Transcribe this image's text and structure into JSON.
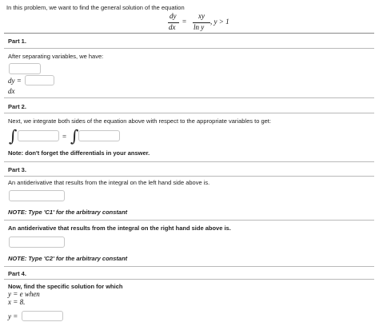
{
  "intro": {
    "text": "In this problem, we want to find the general solution of the equation",
    "equation": {
      "lhs_num": "dy",
      "lhs_den": "dx",
      "equals": "=",
      "rhs_num": "xy",
      "rhs_den": "ln y",
      "condition": ", y > 1"
    }
  },
  "part1": {
    "title": "Part 1.",
    "text": "After separating variables, we have:",
    "dy_label": "dy =",
    "dx_label": "dx"
  },
  "part2": {
    "title": "Part 2.",
    "text": "Next, we integrate both sides of the equation above with respect to the appropriate variables to get:",
    "integral_symbol": "∫",
    "equals": "=",
    "note": "Note: don't forget the differentials in your answer."
  },
  "part3": {
    "title": "Part 3.",
    "text1": "An antiderivative that results from the integral on the left hand side above is.",
    "note1": "NOTE: Type 'C1' for the arbitrary constant",
    "text2": "An antiderivative that results from the integral on the right hand side above is.",
    "note2": "NOTE: Type 'C2' for the arbitrary constant"
  },
  "part4": {
    "title": "Part 4.",
    "text": "Now, find the specific solution for which",
    "cond1": "y = e when",
    "cond2": "x = 8.",
    "y_label": "y ="
  }
}
